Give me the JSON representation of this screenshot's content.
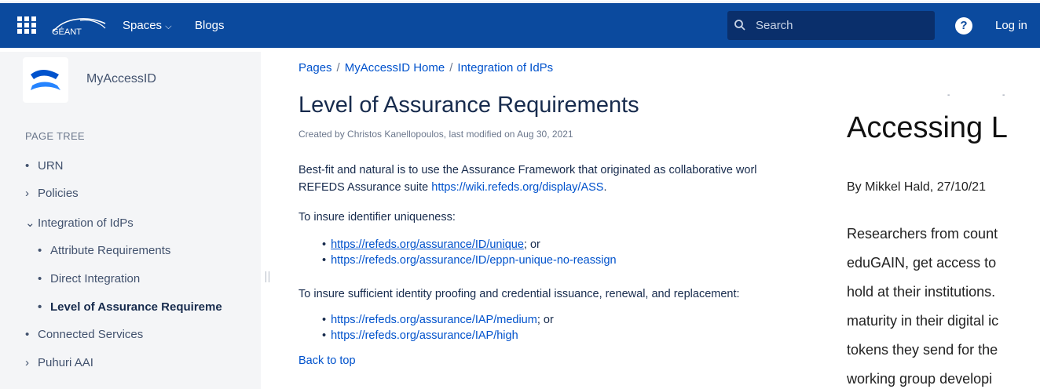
{
  "header": {
    "logo_text": "GÉANT",
    "nav": [
      "Spaces",
      "Blogs"
    ],
    "search_placeholder": "Search",
    "help": "?",
    "login": "Log in"
  },
  "sidebar": {
    "space_name": "MyAccessID",
    "tree_heading": "PAGE TREE",
    "items": [
      {
        "label": "URN",
        "marker": "•"
      },
      {
        "label": "Policies",
        "marker": "›"
      },
      {
        "label": "Integration of IdPs",
        "marker": "⌄"
      },
      {
        "label": "Attribute Requirements",
        "marker": "•"
      },
      {
        "label": "Direct Integration",
        "marker": "•"
      },
      {
        "label": "Level of Assurance Requireme",
        "marker": "•"
      },
      {
        "label": "Connected Services",
        "marker": "•"
      },
      {
        "label": "Puhuri AAI",
        "marker": "›"
      }
    ]
  },
  "breadcrumb": [
    "Pages",
    "MyAccessID Home",
    "Integration of IdPs"
  ],
  "page": {
    "title": "Level of Assurance Requirements",
    "byline": "Created by Christos Kanellopoulos, last modified on Aug 30, 2021",
    "intro_line1": "Best-fit and natural is to use the Assurance Framework that originated as collaborative worl",
    "intro_line2_prefix": "REFEDS Assurance suite ",
    "intro_link": "https://wiki.refeds.org/display/ASS",
    "intro_line2_suffix": ".",
    "uniqueness_heading": "To insure identifier uniqueness:",
    "uniqueness_links": [
      {
        "url": "https://refeds.org/assurance/ID/unique",
        "suffix": "; or"
      },
      {
        "url": "https://refeds.org/assurance/ID/eppn-unique-no-reassign",
        "suffix": ""
      }
    ],
    "proofing_heading": "To insure sufficient identity proofing and credential issuance, renewal, and replacement:",
    "proofing_links": [
      {
        "url": "https://refeds.org/assurance/IAP/medium",
        "suffix": "; or"
      },
      {
        "url": "https://refeds.org/assurance/IAP/high",
        "suffix": ""
      }
    ],
    "back_to_top": "Back to top",
    "more_menu": "•••"
  },
  "side_article": {
    "title": "Accessing L",
    "byline": "By Mikkel Hald, 27/10/21",
    "lines": [
      "Researchers from count",
      "eduGAIN, get access to",
      "hold at their institutions.",
      "maturity in their digital ic",
      "tokens they send for the",
      "working group developi"
    ]
  }
}
